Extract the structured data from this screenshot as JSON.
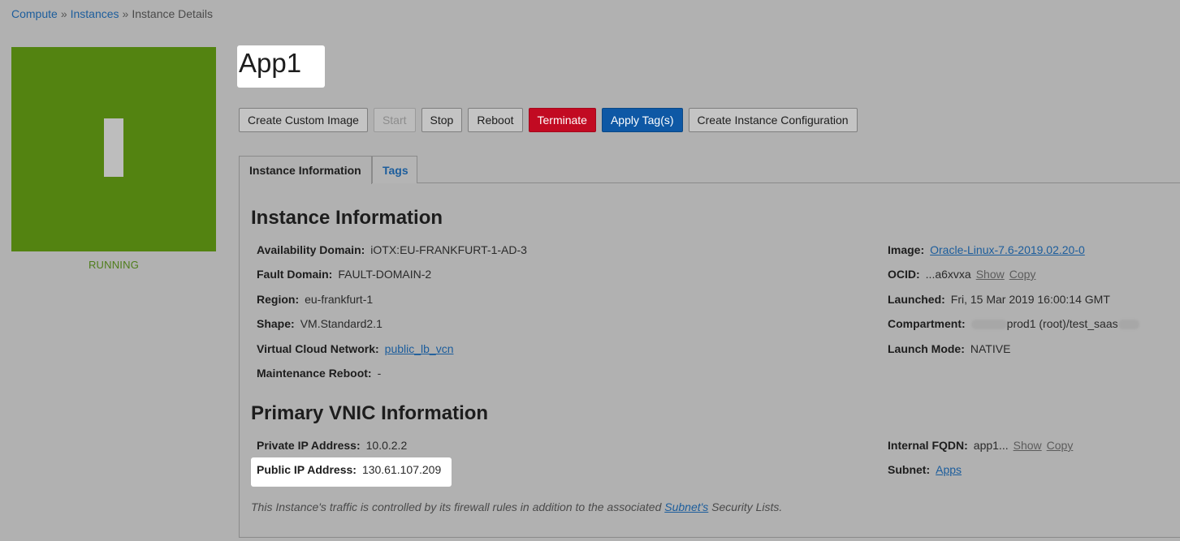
{
  "breadcrumb": {
    "compute": "Compute",
    "instances": "Instances",
    "current": "Instance Details",
    "separator": "»"
  },
  "status": {
    "label": "RUNNING",
    "tile_color": "#538311"
  },
  "instance": {
    "name": "App1"
  },
  "toolbar": {
    "create_custom_image": "Create Custom Image",
    "start": "Start",
    "stop": "Stop",
    "reboot": "Reboot",
    "terminate": "Terminate",
    "apply_tags": "Apply Tag(s)",
    "create_instance_configuration": "Create Instance Configuration"
  },
  "tabs": {
    "instance_information": "Instance Information",
    "tags": "Tags"
  },
  "instance_info": {
    "title": "Instance Information",
    "availability_domain": {
      "label": "Availability Domain:",
      "value": "iOTX:EU-FRANKFURT-1-AD-3"
    },
    "fault_domain": {
      "label": "Fault Domain:",
      "value": "FAULT-DOMAIN-2"
    },
    "region": {
      "label": "Region:",
      "value": "eu-frankfurt-1"
    },
    "shape": {
      "label": "Shape:",
      "value": "VM.Standard2.1"
    },
    "vcn": {
      "label": "Virtual Cloud Network:",
      "value": "public_lb_vcn"
    },
    "maintenance_reboot": {
      "label": "Maintenance Reboot:",
      "value": "-"
    },
    "image": {
      "label": "Image:",
      "value": "Oracle-Linux-7.6-2019.02.20-0"
    },
    "ocid": {
      "label": "OCID:",
      "value": "...a6xvxa",
      "show": "Show",
      "copy": "Copy"
    },
    "launched": {
      "label": "Launched:",
      "value": "Fri, 15 Mar 2019 16:00:14 GMT"
    },
    "compartment": {
      "label": "Compartment:",
      "value": "prod1 (root)/test_saas"
    },
    "launch_mode": {
      "label": "Launch Mode:",
      "value": "NATIVE"
    }
  },
  "vnic_info": {
    "title": "Primary VNIC Information",
    "private_ip": {
      "label": "Private IP Address:",
      "value": "10.0.2.2"
    },
    "public_ip": {
      "label": "Public IP Address:",
      "value": "130.61.107.209"
    },
    "internal_fqdn": {
      "label": "Internal FQDN:",
      "value": "app1...",
      "show": "Show",
      "copy": "Copy"
    },
    "subnet": {
      "label": "Subnet:",
      "value": "Apps"
    }
  },
  "note": {
    "before": "This Instance's traffic is controlled by its firewall rules in addition to the associated ",
    "link": "Subnet's",
    "after": " Security Lists."
  }
}
